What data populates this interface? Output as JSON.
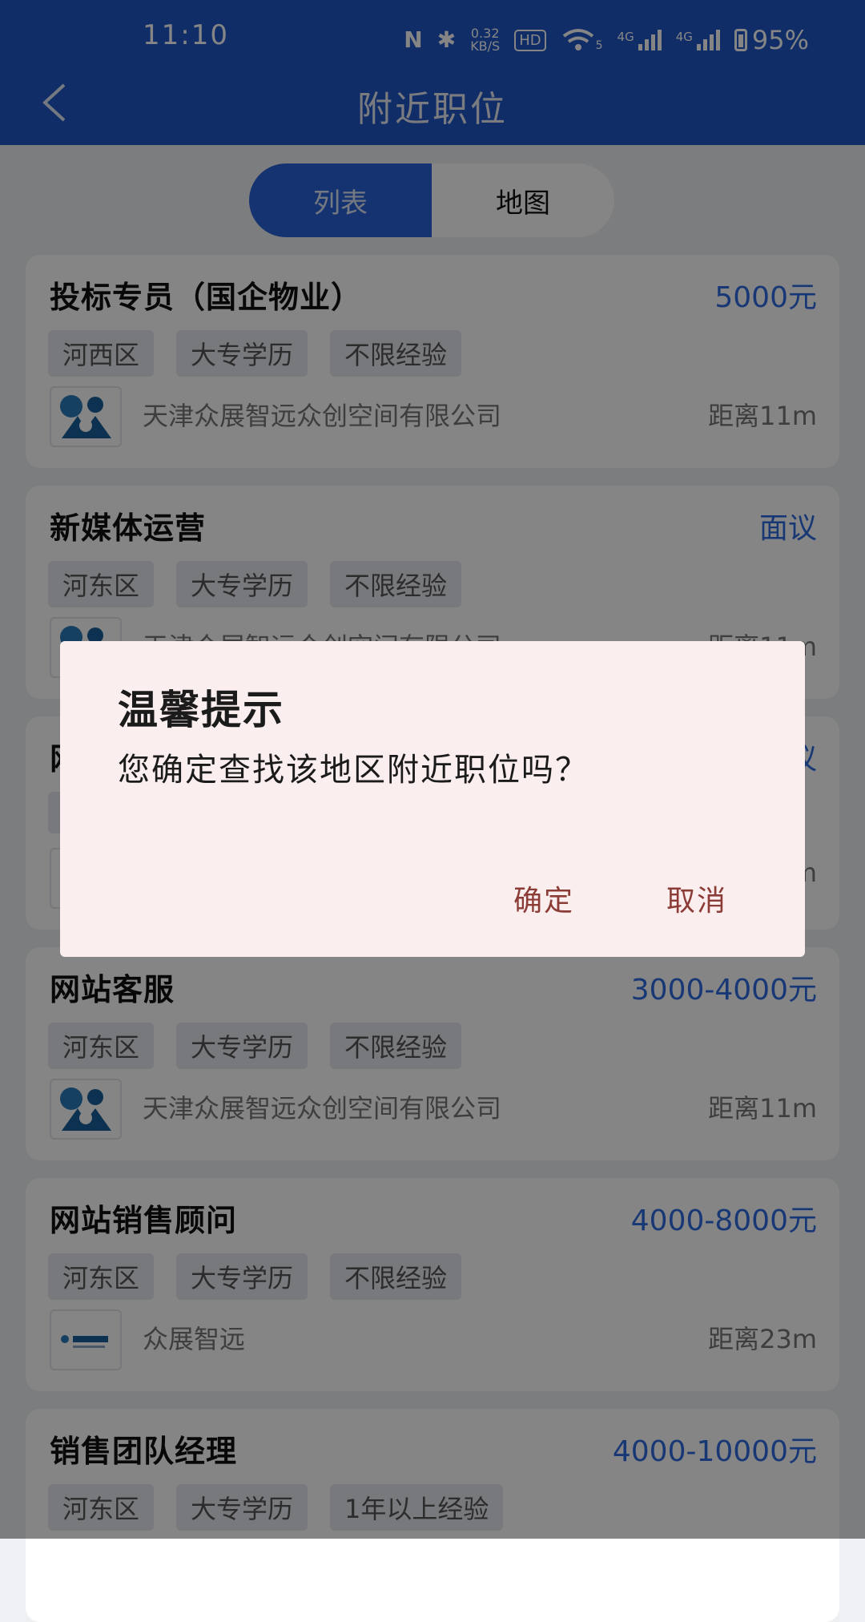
{
  "status": {
    "time": "11:10",
    "nfc": "N",
    "bluetooth": "✱",
    "speed_value": "0.32",
    "speed_unit": "KB/S",
    "hd": "HD",
    "wifi": "5",
    "signal1_label": "4G",
    "signal2_label": "4G",
    "battery": "95%"
  },
  "header": {
    "title": "附近职位"
  },
  "toggle": {
    "list_label": "列表",
    "map_label": "地图"
  },
  "jobs": [
    {
      "title": "投标专员（国企物业）",
      "salary": "5000元",
      "tags": [
        "河西区",
        "大专学历",
        "不限经验"
      ],
      "company": "天津众展智远众创空间有限公司",
      "distance": "距离11m"
    },
    {
      "title": "新媒体运营",
      "salary": "面议",
      "tags": [
        "河东区",
        "大专学历",
        "不限经验"
      ],
      "company": "天津众展智远众创空间有限公司",
      "distance": "距离11m"
    },
    {
      "title": "网",
      "salary": "议",
      "tags": [
        "",
        "",
        ""
      ],
      "company": "",
      "distance": "m"
    },
    {
      "title": "网站客服",
      "salary": "3000-4000元",
      "tags": [
        "河东区",
        "大专学历",
        "不限经验"
      ],
      "company": "天津众展智远众创空间有限公司",
      "distance": "距离11m"
    },
    {
      "title": "网站销售顾问",
      "salary": "4000-8000元",
      "tags": [
        "河东区",
        "大专学历",
        "不限经验"
      ],
      "company": "众展智远",
      "distance": "距离23m"
    },
    {
      "title": "销售团队经理",
      "salary": "4000-10000元",
      "tags": [
        "河东区",
        "大专学历",
        "1年以上经验"
      ],
      "company": "",
      "distance": ""
    }
  ],
  "dialog": {
    "title": "温馨提示",
    "message": "您确定查找该地区附近职位吗？",
    "confirm": "确定",
    "cancel": "取消"
  },
  "colors": {
    "header": "#1f57c8",
    "salary": "#2f6ae0",
    "dialog_button": "#8c3c36",
    "dialog_bg": "#fbeeee"
  }
}
